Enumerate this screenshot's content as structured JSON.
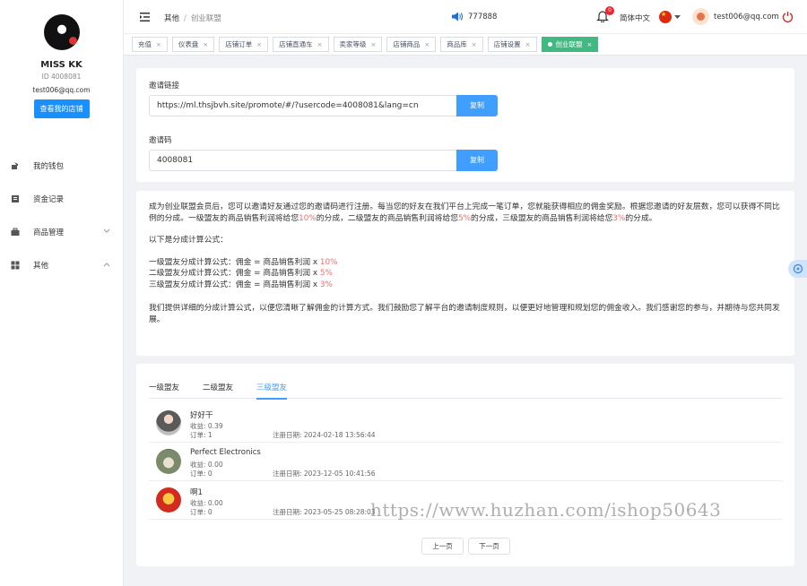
{
  "sidebar": {
    "name": "MISS KK",
    "id": "ID 4008081",
    "email": "test006@qq.com",
    "store_button": "查看我的店铺",
    "menu": [
      {
        "label": "我的钱包",
        "icon": "wallet-icon"
      },
      {
        "label": "资金记录",
        "icon": "record-icon"
      },
      {
        "label": "商品管理",
        "icon": "briefcase-icon",
        "chevron": "down"
      },
      {
        "label": "其他",
        "icon": "grid-icon",
        "chevron": "up"
      }
    ]
  },
  "header": {
    "breadcrumb": [
      "其他",
      "创业联盟"
    ],
    "notice_count": "777888",
    "bell_badge": "0",
    "language": "简体中文",
    "user_email": "test006@qq.com"
  },
  "tabs": [
    {
      "label": "充值",
      "active": false
    },
    {
      "label": "仪表盘",
      "active": false
    },
    {
      "label": "店铺订单",
      "active": false
    },
    {
      "label": "店铺直通车",
      "active": false
    },
    {
      "label": "卖家等级",
      "active": false
    },
    {
      "label": "店铺商品",
      "active": false
    },
    {
      "label": "商品库",
      "active": false
    },
    {
      "label": "店铺设置",
      "active": false
    },
    {
      "label": "创业联盟",
      "active": true
    }
  ],
  "invite": {
    "link_label": "邀请链接",
    "link_value": "https://ml.thsjbvh.site/promote/#/?usercode=4008081&lang=cn",
    "code_label": "邀请码",
    "code_value": "4008081",
    "copy_label": "复制"
  },
  "description": {
    "intro_1": "成为创业联盟会员后，您可以邀请好友通过您的邀请码进行注册。每当您的好友在我们平台上完成一笔订单，您就能获得相应的佣金奖励。根据您邀请的好友层数，您可以获得不同比例的分成。一级盟友的商品销售利润将给您",
    "pct_1": "10%",
    "intro_2": "的分成，二级盟友的商品销售利润将给您",
    "pct_2": "5%",
    "intro_3": "的分成，三级盟友的商品销售利润将给您",
    "pct_3": "3%",
    "intro_4": "的分成。",
    "formula_title": "以下是分成计算公式：",
    "formula_1": "一级盟友分成计算公式：佣金 = 商品销售利润 x ",
    "formula_2": "二级盟友分成计算公式：佣金 = 商品销售利润 x ",
    "formula_3": "三级盟友分成计算公式：佣金 = 商品销售利润 x ",
    "closing": "我们提供详细的分成计算公式，以便您清晰了解佣金的计算方式。我们鼓励您了解平台的邀请制度规则，以便更好地管理和规划您的佣金收入。我们感谢您的参与，并期待与您共同发展。"
  },
  "level_tabs": [
    {
      "label": "一级盟友",
      "active": false
    },
    {
      "label": "二级盟友",
      "active": false
    },
    {
      "label": "三级盟友",
      "active": true
    }
  ],
  "members": [
    {
      "name": "好好干",
      "income": "收益: 0.39",
      "orders": "订单: 1",
      "date": "注册日期: 2024-02-18 13:56:44"
    },
    {
      "name": "Perfect Electronics",
      "income": "收益: 0.00",
      "orders": "订单: 0",
      "date": "注册日期: 2023-12-05 10:41:56"
    },
    {
      "name": "啊1",
      "income": "收益: 0.00",
      "orders": "订单: 0",
      "date": "注册日期: 2023-05-25 08:28:03"
    }
  ],
  "pager": {
    "prev": "上一页",
    "next": "下一页"
  },
  "watermark": "https://www.huzhan.com/ishop50643",
  "colors": {
    "primary": "#409eff",
    "store_button": "#1890ff",
    "active_tab": "#42b983",
    "highlight": "#f56c6c"
  }
}
